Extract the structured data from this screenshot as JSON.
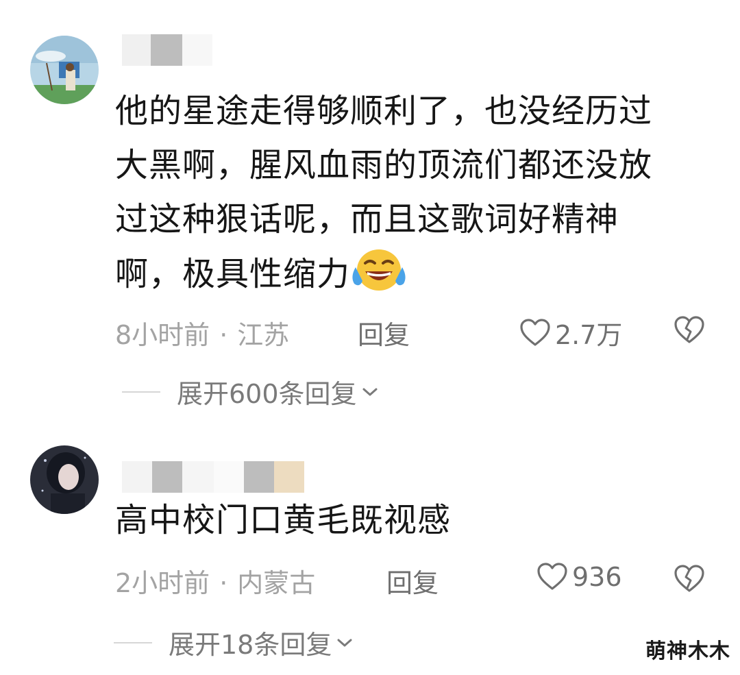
{
  "comments": [
    {
      "text_lines": [
        "他的星途走得够顺利了，也没经历过",
        "大黑啊，腥风血雨的顶流们都还没放",
        "过这种狠话呢，而且这歌词好精神",
        "啊，极具性缩力"
      ],
      "emoji": "laughing-tears-icon",
      "time": "8小时前",
      "separator": "·",
      "location": "江苏",
      "reply_label": "回复",
      "likes": "2.7万",
      "expand_label": "展开600条回复"
    },
    {
      "text_lines": [
        "高中校门口黄毛既视感"
      ],
      "time": "2小时前",
      "separator": "·",
      "location": "内蒙古",
      "reply_label": "回复",
      "likes": "936",
      "expand_label": "展开18条回复"
    }
  ],
  "watermark": "萌神木木",
  "colors": {
    "text": "#161616",
    "meta": "#a3a3a3",
    "action": "#6f6f6f",
    "censor_light": "#f0f0f0",
    "censor_mid": "#bdbdbd",
    "censor_beige": "#eddcc0"
  }
}
